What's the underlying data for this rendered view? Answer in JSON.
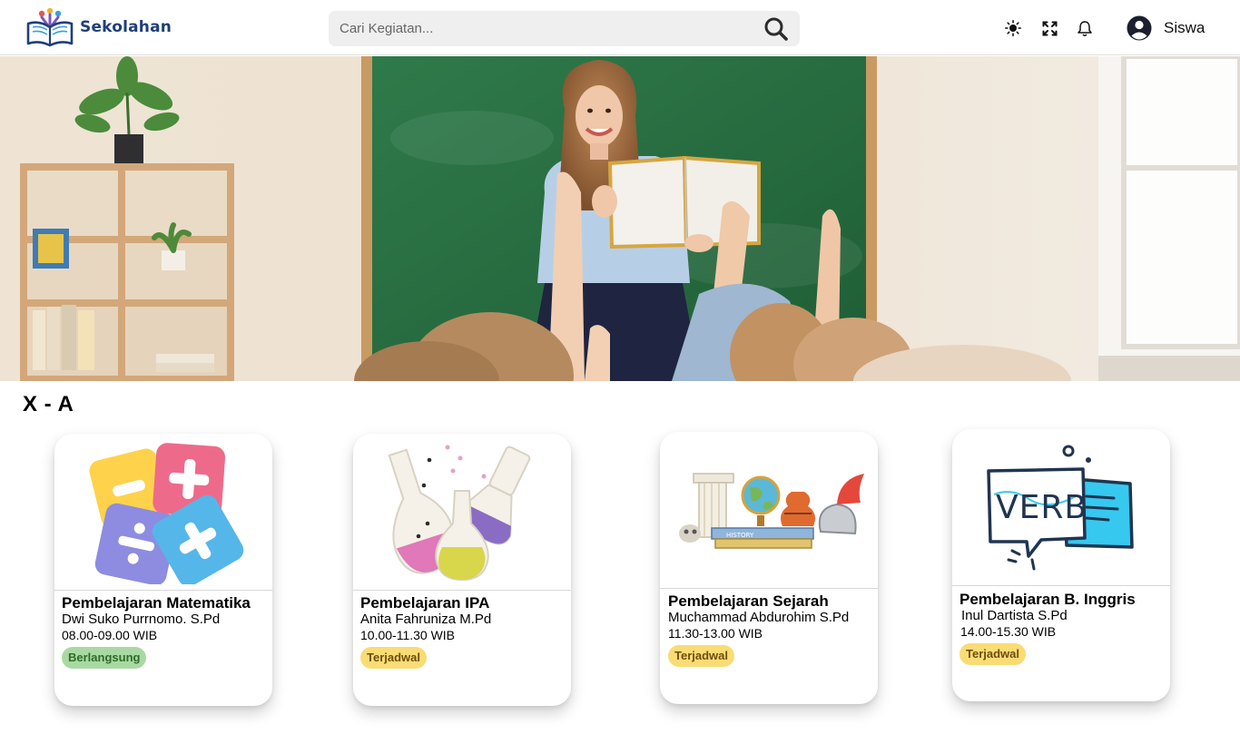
{
  "app": {
    "name": "Sekolahan"
  },
  "header": {
    "search_placeholder": "Cari Kegiatan...",
    "icons": [
      "sun-icon",
      "fullscreen-icon",
      "bell-icon"
    ],
    "user": {
      "name": "Siswa"
    }
  },
  "hero": {
    "image": "teacher-classroom-photo"
  },
  "class": {
    "title": "X - A"
  },
  "colors": {
    "brand": "#1f3f7a",
    "live_badge": "#a9d9a2",
    "scheduled_badge": "#f9dc74"
  },
  "courses": [
    {
      "title": "Pembelajaran Matematika",
      "teacher": "Dwi Suko Purrnomo. S.Pd",
      "time": "08.00-09.00 WIB",
      "status": "Berlangsung",
      "icon": "math-symbols-icon"
    },
    {
      "title": "Pembelajaran IPA",
      "teacher": "Anita Fahruniza M.Pd",
      "time": "10.00-11.30 WIB",
      "status": "Terjadwal",
      "icon": "science-flasks-icon"
    },
    {
      "title": "Pembelajaran Sejarah",
      "teacher": "Muchammad Abdurohim S.Pd",
      "time": "11.30-13.00 WIB",
      "status": "Terjadwal",
      "icon": "history-artifacts-icon"
    },
    {
      "title": "Pembelajaran B. Inggris",
      "teacher": "Inul Dartista S.Pd",
      "time": "14.00-15.30 WIB",
      "status": "Terjadwal",
      "icon": "verb-speech-bubble-icon"
    }
  ]
}
